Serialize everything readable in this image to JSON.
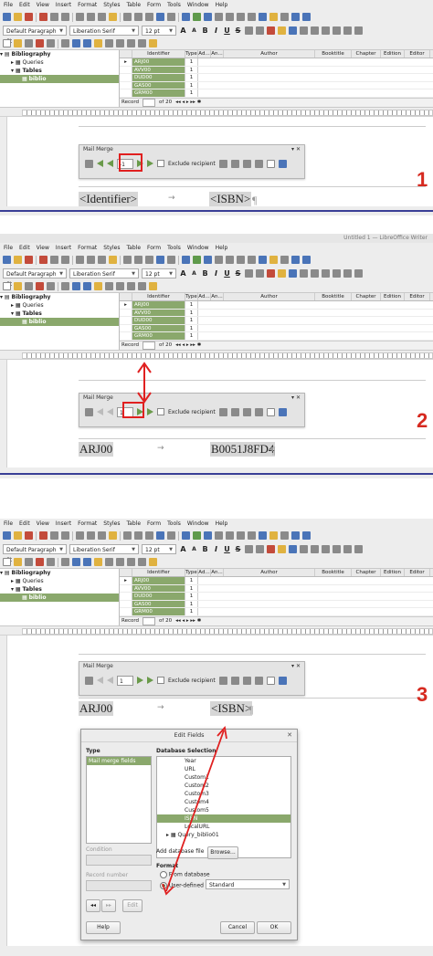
{
  "titlebar": {
    "title2": "Untitled 1 — LibreOffice Writer"
  },
  "menu": [
    "File",
    "Edit",
    "View",
    "Insert",
    "Format",
    "Styles",
    "Table",
    "Form",
    "Tools",
    "Window",
    "Help"
  ],
  "format_bar": {
    "para_style": "Default Paragraph St",
    "font": "Liberation Serif",
    "size": "12 pt"
  },
  "tree": {
    "items": [
      "Bibliography",
      "Queries",
      "Tables",
      "biblio"
    ]
  },
  "grid": {
    "headers": [
      "Identifier",
      "Type",
      "Ad...",
      "An...",
      "Author",
      "Booktitle",
      "Chapter",
      "Edition",
      "Editor"
    ],
    "rows": [
      [
        "ARJ00",
        "1"
      ],
      [
        "AVV00",
        "1"
      ],
      [
        "DUD00",
        "1"
      ],
      [
        "GAS00",
        "1"
      ],
      [
        "GRM00",
        "1"
      ]
    ],
    "record_label": "Record",
    "record_of": "of 20"
  },
  "mailmerge": {
    "title": "Mail Merge",
    "exclude": "Exclude recipient",
    "value1": "-1",
    "value2": "1",
    "value3": "1"
  },
  "doc": {
    "p1_left": "<Identifier>",
    "p1_right": "<ISBN>",
    "p2_left": "ARJ00",
    "p2_right": "B0051J8FD4",
    "p3_left": "ARJ00",
    "p3_right": "<ISBN>",
    "arrow": "→",
    "pilcrow": "¶"
  },
  "step_numbers": [
    "1",
    "2",
    "3"
  ],
  "dialog": {
    "title": "Edit Fields",
    "type_label": "Type",
    "type_item": "Mail merge fields",
    "db_label": "Database Selection",
    "db_items": [
      "Year",
      "URL",
      "Custom1",
      "Custom2",
      "Custom3",
      "Custom4",
      "Custom5",
      "ISBN",
      "LocalURL",
      "Query_biblio01"
    ],
    "condition": "Condition",
    "record_number": "Record number",
    "add_db": "Add database file",
    "browse": "Browse...",
    "format_label": "Format",
    "fmt_db": "From database",
    "fmt_user": "User-defined",
    "fmt_value": "Standard",
    "edit": "Edit",
    "help": "Help",
    "cancel": "Cancel",
    "ok": "OK"
  },
  "colors": {
    "accent_green": "#8aa86c",
    "annot_red": "#e02020",
    "step_red": "#d62a20",
    "divider_blue": "#3a3f96"
  }
}
